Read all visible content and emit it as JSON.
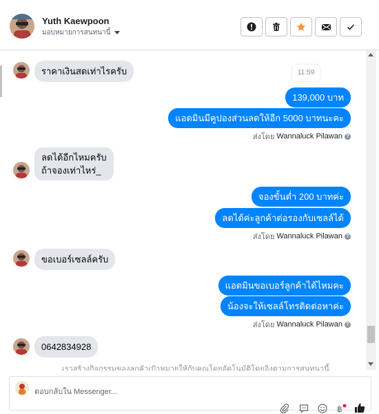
{
  "header": {
    "name": "Yuth Kaewpoon",
    "assign_label": "มอบหมายการสนทนานี้",
    "buttons": [
      {
        "id": "spam",
        "icon": "alert-icon"
      },
      {
        "id": "delete",
        "icon": "trash-icon"
      },
      {
        "id": "star",
        "icon": "star-icon"
      },
      {
        "id": "unread",
        "icon": "envelope-icon"
      },
      {
        "id": "done",
        "icon": "check-icon"
      }
    ]
  },
  "conversation": {
    "timestamp": "11:59",
    "messages": [
      {
        "from": "customer",
        "text": "ราคาเงินสดเท่าไรครับ"
      },
      {
        "from": "page",
        "text": "139,000 บาท"
      },
      {
        "from": "page",
        "text": "แอดมินมีคูปองส่วนลดให้อีก 5000 บาทนะคะ"
      },
      {
        "from": "customer",
        "line1": "ลดได้อีกไหมครับ",
        "line2": "ถ้าจองเท่าไหร่_"
      },
      {
        "from": "page",
        "text": "จองขั้นต่ำ 200 บาทค่ะ"
      },
      {
        "from": "page",
        "text": "ลดได้ค่ะลูกค้าต่อรองกับเซลล์ได้"
      },
      {
        "from": "customer",
        "text": "ขอเบอร์เซลล์ครับ"
      },
      {
        "from": "page",
        "text": "แอดมินขอเบอร์ลูกค้าได้ไหมคะ"
      },
      {
        "from": "page",
        "text": "น้องจะให้เซลล์โทรติดต่อหาค่ะ"
      },
      {
        "from": "customer",
        "text": "0642834928"
      }
    ],
    "sent_by_prefix": "ส่งโดย",
    "sent_by_name": "Wannaluck Pilawan",
    "notice": "เราสร้างกิจกรรมของลูกค้าเป้าหมายให้กับคุณโดยอัตโนมัติโดยอิงตามการสนทนานี้"
  },
  "composer": {
    "placeholder": "ตอบกลับใน Messenger...",
    "icons": [
      "paperclip-icon",
      "saved-reply-icon",
      "emoji-icon",
      "payment-icon",
      "like-icon"
    ]
  },
  "colors": {
    "outgoing_bubble": "#0084ff",
    "incoming_bubble": "#e4e6eb",
    "star": "#f7923b"
  }
}
